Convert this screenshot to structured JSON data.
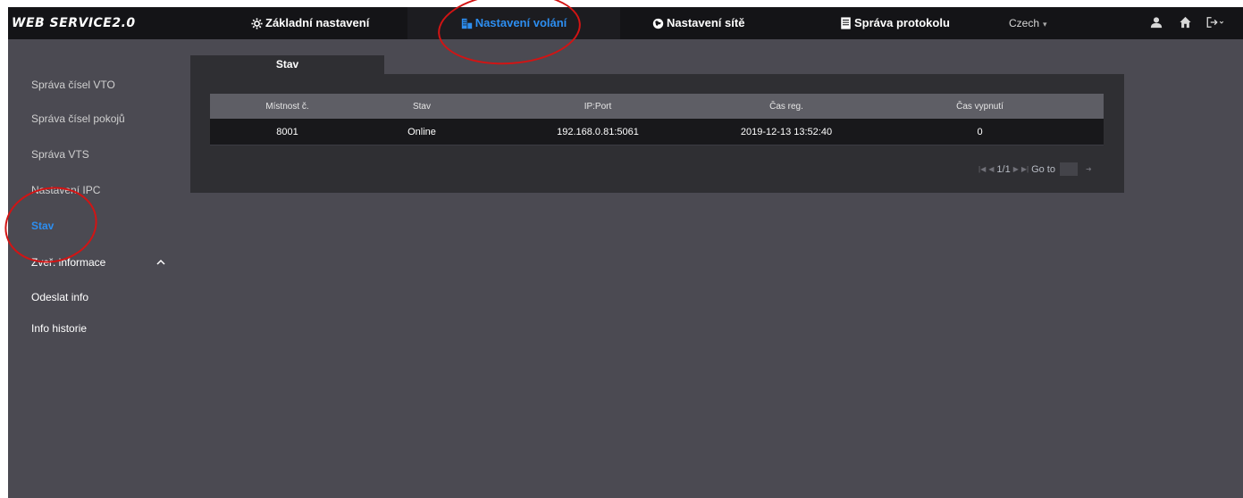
{
  "header": {
    "logo": "WEB SERVICE2.0",
    "nav": [
      {
        "label": "Základní nastavení",
        "icon": "gear-icon"
      },
      {
        "label": "Nastavení volání",
        "icon": "building-icon",
        "active": true
      },
      {
        "label": "Nastavení sítě",
        "icon": "globe-icon"
      },
      {
        "label": "Správa protokolu",
        "icon": "document-icon"
      }
    ],
    "language": "Czech",
    "icons": [
      "user-icon",
      "home-icon",
      "logout-icon"
    ]
  },
  "sidebar": {
    "items": [
      {
        "label": "Správa čísel VTO"
      },
      {
        "label": "Správa čísel pokojů"
      },
      {
        "label": "Správa VTS"
      },
      {
        "label": "Nastavení IPC"
      },
      {
        "label": "Stav",
        "active": true
      },
      {
        "label": "Zveř. informace",
        "expanded": true
      },
      {
        "label": "Odeslat info"
      },
      {
        "label": "Info historie"
      }
    ]
  },
  "main": {
    "tab": "Stav",
    "table": {
      "columns": [
        "Místnost č.",
        "Stav",
        "IP:Port",
        "Čas reg.",
        "Čas vypnutí"
      ],
      "rows": [
        [
          "8001",
          "Online",
          "192.168.0.81:5061",
          "2019-12-13 13:52:40",
          "0"
        ]
      ]
    },
    "pager": {
      "page": "1/1",
      "goto_label": "Go to",
      "goto_value": ""
    }
  },
  "colors": {
    "accent": "#2d8ef0",
    "background": "#4b4a52",
    "topbar": "#141417",
    "annotation": "#d21414"
  }
}
